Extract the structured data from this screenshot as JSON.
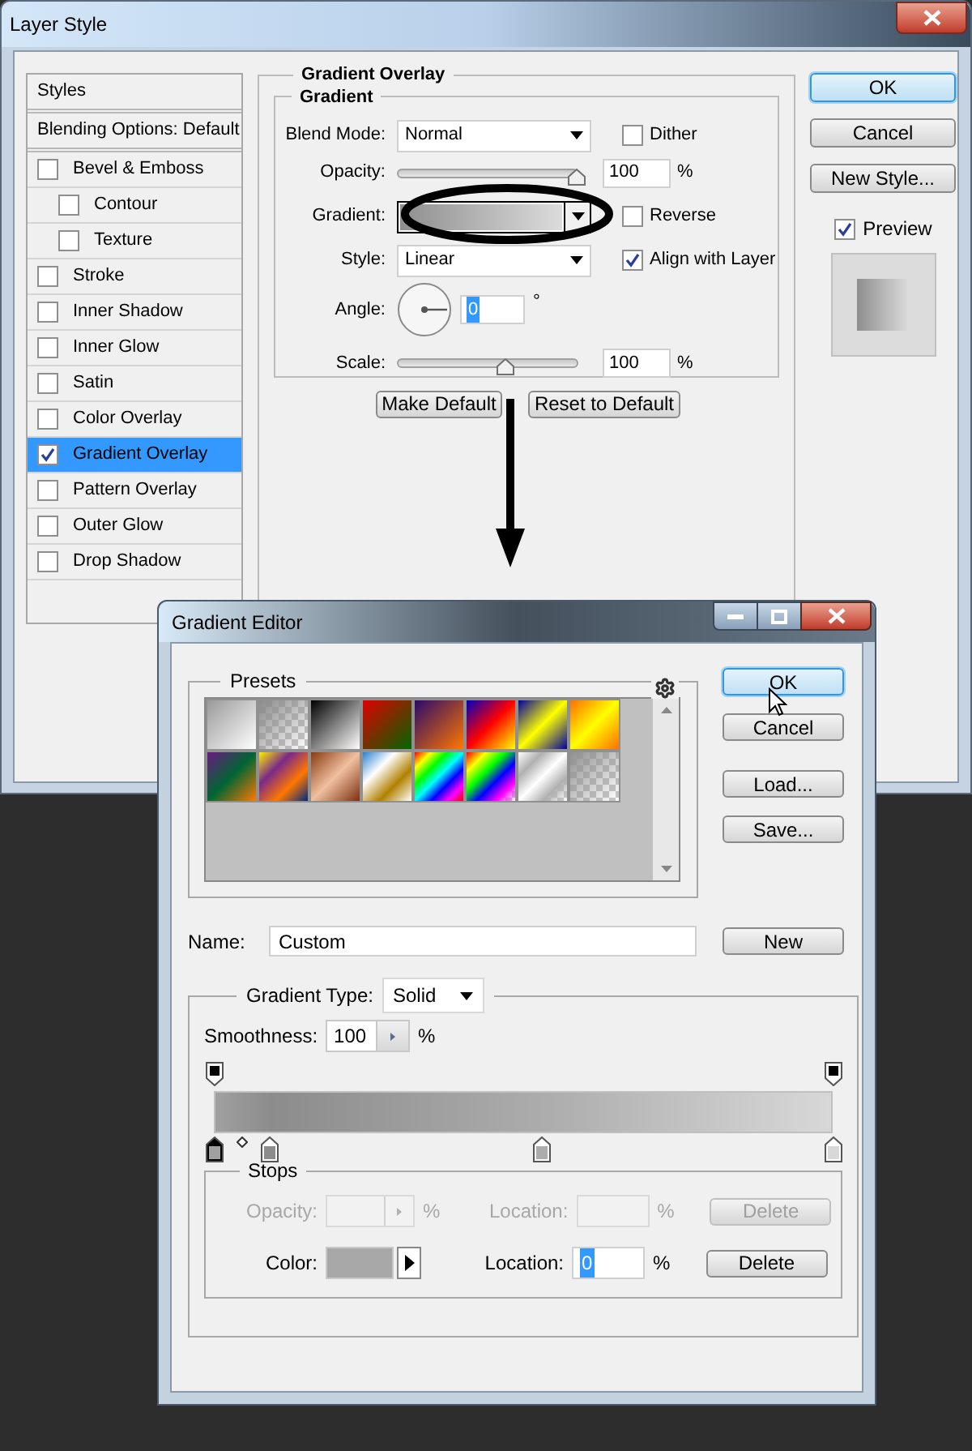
{
  "layer_style": {
    "title": "Layer Style",
    "styles": [
      {
        "kind": "header",
        "label": "Styles",
        "selected": false
      },
      {
        "kind": "header",
        "label": "Blending Options: Default",
        "selected": false
      },
      {
        "kind": "effect",
        "label": "Bevel & Emboss",
        "checked": false,
        "selected": false
      },
      {
        "kind": "sub",
        "label": "Contour",
        "checked": false,
        "selected": false
      },
      {
        "kind": "sub",
        "label": "Texture",
        "checked": false,
        "selected": false
      },
      {
        "kind": "effect",
        "label": "Stroke",
        "checked": false,
        "selected": false
      },
      {
        "kind": "effect",
        "label": "Inner Shadow",
        "checked": false,
        "selected": false
      },
      {
        "kind": "effect",
        "label": "Inner Glow",
        "checked": false,
        "selected": false
      },
      {
        "kind": "effect",
        "label": "Satin",
        "checked": false,
        "selected": false
      },
      {
        "kind": "effect",
        "label": "Color Overlay",
        "checked": false,
        "selected": false
      },
      {
        "kind": "effect",
        "label": "Gradient Overlay",
        "checked": true,
        "selected": true
      },
      {
        "kind": "effect",
        "label": "Pattern Overlay",
        "checked": false,
        "selected": false
      },
      {
        "kind": "effect",
        "label": "Outer Glow",
        "checked": false,
        "selected": false
      },
      {
        "kind": "effect",
        "label": "Drop Shadow",
        "checked": false,
        "selected": false
      }
    ],
    "panel_title": "Gradient Overlay",
    "group_title": "Gradient",
    "blend_mode": {
      "label": "Blend Mode:",
      "value": "Normal"
    },
    "dither": {
      "label": "Dither",
      "checked": false
    },
    "opacity": {
      "label": "Opacity:",
      "value": "100",
      "unit": "%",
      "level": 1
    },
    "gradient": {
      "label": "Gradient:"
    },
    "reverse": {
      "label": "Reverse",
      "checked": false
    },
    "style": {
      "label": "Style:",
      "value": "Linear"
    },
    "align": {
      "label": "Align with Layer",
      "checked": true
    },
    "angle": {
      "label": "Angle:",
      "value": "0",
      "unit": "°"
    },
    "scale": {
      "label": "Scale:",
      "value": "100",
      "unit": "%",
      "level": 0.6
    },
    "buttons": [
      "Make Default",
      "Reset to Default"
    ],
    "side_buttons": [
      {
        "label": "OK",
        "default": true
      },
      {
        "label": "Cancel",
        "default": false
      },
      {
        "label": "New Style...",
        "default": false
      }
    ],
    "preview": {
      "label": "Preview",
      "checked": true
    }
  },
  "gradient_editor": {
    "title": "Gradient Editor",
    "presets_label": "Presets",
    "buttons": [
      {
        "label": "OK",
        "default": true
      },
      {
        "label": "Cancel",
        "default": false
      },
      {
        "label": "Load...",
        "default": false
      },
      {
        "label": "Save...",
        "default": false
      }
    ],
    "name": {
      "label": "Name:",
      "value": "Custom"
    },
    "new_button": "New",
    "gradient_type": {
      "label": "Gradient Type:",
      "value": "Solid"
    },
    "smoothness": {
      "label": "Smoothness:",
      "value": "100",
      "unit": "%"
    },
    "opacity_stops": [
      {
        "level": 0,
        "selected": false
      },
      {
        "level": 1,
        "selected": false
      }
    ],
    "color_stops": [
      {
        "level": 0,
        "color": "#a0a0a0",
        "selected": true
      },
      {
        "level": 0.09,
        "color": "#8c8c8c",
        "selected": false
      },
      {
        "level": 0.53,
        "color": "#acacac",
        "selected": false
      },
      {
        "level": 1,
        "color": "#d8d8d8",
        "selected": false
      }
    ],
    "midpoint": {
      "level": 0.045
    },
    "stops": {
      "label": "Stops",
      "opacity": {
        "label": "Opacity:",
        "unit": "%",
        "disabled": true
      },
      "opacity_location": {
        "label": "Location:",
        "unit": "%",
        "disabled": true
      },
      "opacity_delete": {
        "label": "Delete",
        "disabled": true
      },
      "color": {
        "label": "Color:",
        "color": "#a8a8a8"
      },
      "color_location": {
        "label": "Location:",
        "value": "0",
        "unit": "%"
      },
      "color_delete": {
        "label": "Delete",
        "disabled": false
      }
    }
  }
}
